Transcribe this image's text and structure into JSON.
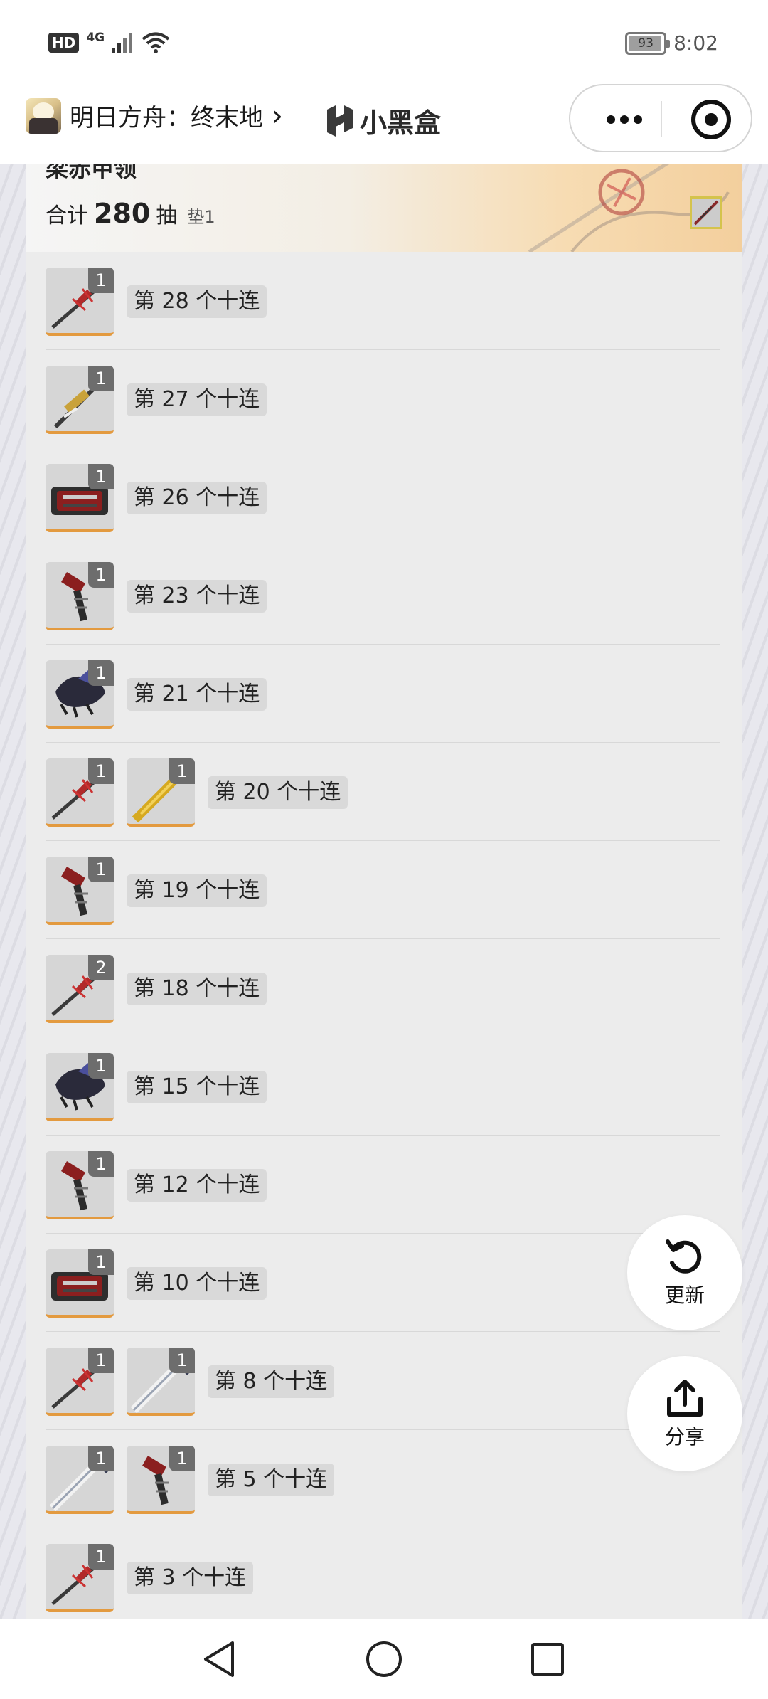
{
  "status_bar": {
    "hd": "HD",
    "network": "4G",
    "battery": "93",
    "time": "8:02"
  },
  "header": {
    "app_title": "明日方舟：终末地",
    "chevron": "›",
    "brand": "小黑盒",
    "more_icon": "more-dots-icon",
    "close_icon": "target-close-icon"
  },
  "card": {
    "title": "梁赤甲领",
    "total_prefix": "合计",
    "total_value": "280",
    "total_suffix": "抽",
    "pity": "垫1"
  },
  "rows": [
    {
      "label": "第 28 个十连",
      "items": [
        {
          "icon": "red-spear-icon",
          "count": "1"
        }
      ]
    },
    {
      "label": "第 27 个十连",
      "items": [
        {
          "icon": "gold-spear-icon",
          "count": "1"
        }
      ]
    },
    {
      "label": "第 26 个十连",
      "items": [
        {
          "icon": "red-launcher-icon",
          "count": "1"
        }
      ]
    },
    {
      "label": "第 23 个十连",
      "items": [
        {
          "icon": "red-blade-icon",
          "count": "1"
        }
      ]
    },
    {
      "label": "第 21 个十连",
      "items": [
        {
          "icon": "dark-claw-icon",
          "count": "1"
        }
      ]
    },
    {
      "label": "第 20 个十连",
      "items": [
        {
          "icon": "red-spear-icon",
          "count": "1"
        },
        {
          "icon": "gold-sword-icon",
          "count": "1"
        }
      ]
    },
    {
      "label": "第 19 个十连",
      "items": [
        {
          "icon": "red-blade-icon",
          "count": "1"
        }
      ]
    },
    {
      "label": "第 18 个十连",
      "items": [
        {
          "icon": "red-spear-icon",
          "count": "2"
        }
      ]
    },
    {
      "label": "第 15 个十连",
      "items": [
        {
          "icon": "dark-claw-icon",
          "count": "1"
        }
      ]
    },
    {
      "label": "第 12 个十连",
      "items": [
        {
          "icon": "red-blade-icon",
          "count": "1"
        }
      ]
    },
    {
      "label": "第 10 个十连",
      "items": [
        {
          "icon": "red-launcher-icon",
          "count": "1"
        }
      ]
    },
    {
      "label": "第 8 个十连",
      "items": [
        {
          "icon": "red-spear-icon",
          "count": "1"
        },
        {
          "icon": "silver-sword-icon",
          "count": "1"
        }
      ]
    },
    {
      "label": "第 5 个十连",
      "items": [
        {
          "icon": "silver-sword-icon",
          "count": "1"
        },
        {
          "icon": "red-blade-icon",
          "count": "1"
        }
      ]
    },
    {
      "label": "第 3 个十连",
      "items": [
        {
          "icon": "red-spear-icon",
          "count": "1"
        }
      ]
    }
  ],
  "fab": {
    "refresh_label": "更新",
    "share_label": "分享"
  },
  "colors": {
    "accent_underline": "#e39a3f",
    "count_badge": "#6d6d6d",
    "card_bg": "#ececec"
  }
}
